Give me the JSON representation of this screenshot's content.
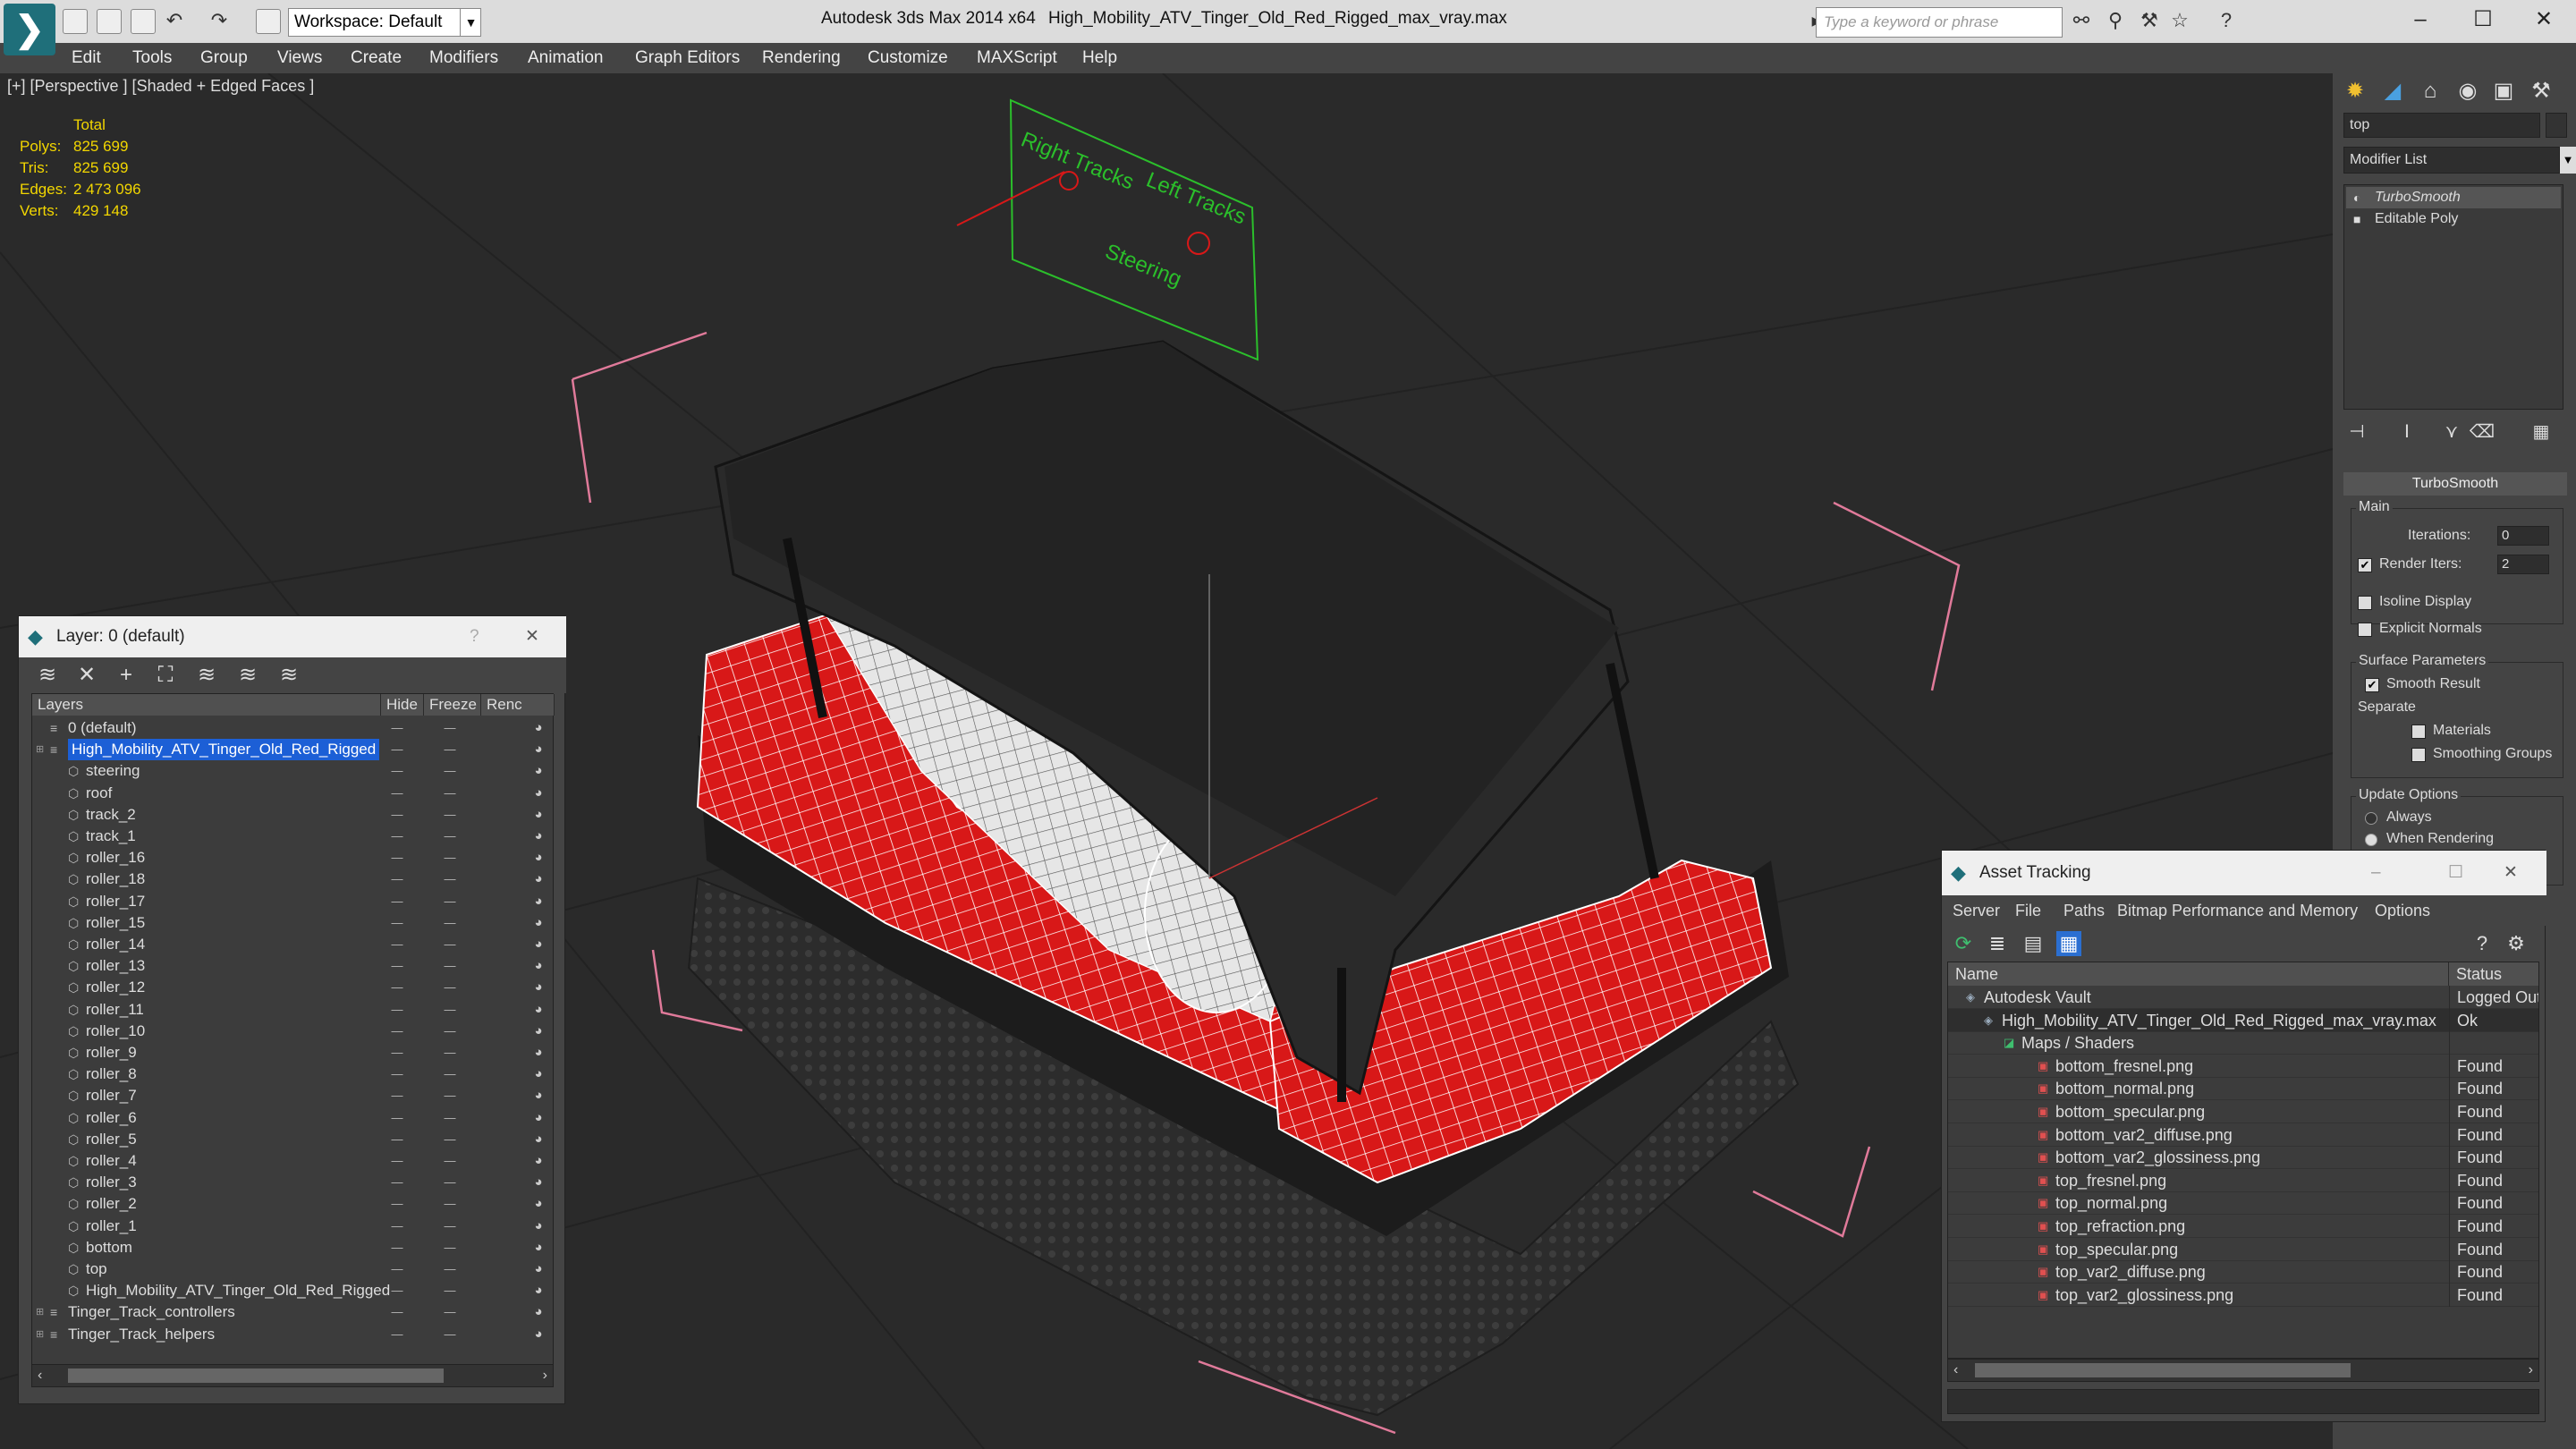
{
  "app": {
    "title": "Autodesk 3ds Max  2014 x64",
    "file": "High_Mobility_ATV_Tinger_Old_Red_Rigged_max_vray.max",
    "workspace": "Workspace: Default",
    "search_placeholder": "Type a keyword or phrase"
  },
  "menu": [
    "Edit",
    "Tools",
    "Group",
    "Views",
    "Create",
    "Modifiers",
    "Animation",
    "Graph Editors",
    "Rendering",
    "Customize",
    "MAXScript",
    "Help"
  ],
  "viewport": {
    "label": "[+] [Perspective ] [Shaded + Edged Faces ]",
    "stats": {
      "header": "Total",
      "rows": [
        {
          "label": "Polys:",
          "value": "825 699"
        },
        {
          "label": "Tris:",
          "value": "825 699"
        },
        {
          "label": "Edges:",
          "value": "2 473 096"
        },
        {
          "label": "Verts:",
          "value": "429 148"
        }
      ]
    },
    "helper_labels": [
      "Right Tracks",
      "Left Tracks",
      "Steering"
    ]
  },
  "layer_panel": {
    "title": "Layer: 0 (default)",
    "columns": [
      "Layers",
      "Hide",
      "Freeze",
      "Renc"
    ],
    "rows": [
      {
        "name": "0 (default)",
        "level": 0
      },
      {
        "name": "High_Mobility_ATV_Tinger_Old_Red_Rigged",
        "level": 0,
        "selected": true
      },
      {
        "name": "steering",
        "level": 1
      },
      {
        "name": "roof",
        "level": 1
      },
      {
        "name": "track_2",
        "level": 1
      },
      {
        "name": "track_1",
        "level": 1
      },
      {
        "name": "roller_16",
        "level": 1
      },
      {
        "name": "roller_18",
        "level": 1
      },
      {
        "name": "roller_17",
        "level": 1
      },
      {
        "name": "roller_15",
        "level": 1
      },
      {
        "name": "roller_14",
        "level": 1
      },
      {
        "name": "roller_13",
        "level": 1
      },
      {
        "name": "roller_12",
        "level": 1
      },
      {
        "name": "roller_11",
        "level": 1
      },
      {
        "name": "roller_10",
        "level": 1
      },
      {
        "name": "roller_9",
        "level": 1
      },
      {
        "name": "roller_8",
        "level": 1
      },
      {
        "name": "roller_7",
        "level": 1
      },
      {
        "name": "roller_6",
        "level": 1
      },
      {
        "name": "roller_5",
        "level": 1
      },
      {
        "name": "roller_4",
        "level": 1
      },
      {
        "name": "roller_3",
        "level": 1
      },
      {
        "name": "roller_2",
        "level": 1
      },
      {
        "name": "roller_1",
        "level": 1
      },
      {
        "name": "bottom",
        "level": 1
      },
      {
        "name": "top",
        "level": 1
      },
      {
        "name": "High_Mobility_ATV_Tinger_Old_Red_Rigged",
        "level": 1
      },
      {
        "name": "Tinger_Track_controllers",
        "level": 0
      },
      {
        "name": "Tinger_Track_helpers",
        "level": 0
      }
    ]
  },
  "command_panel": {
    "object_name": "top",
    "modifier_list": "Modifier List",
    "stack": [
      "TurboSmooth",
      "Editable Poly"
    ],
    "turbosmooth": {
      "title": "TurboSmooth",
      "main_label": "Main",
      "iterations_label": "Iterations:",
      "iterations_value": "0",
      "render_iters_label": "Render Iters:",
      "render_iters_value": "2",
      "isoline": "Isoline Display",
      "explicit_normals": "Explicit Normals",
      "surface_params": "Surface Parameters",
      "smooth_result": "Smooth Result",
      "separate": "Separate",
      "materials": "Materials",
      "smoothing_groups": "Smoothing Groups",
      "update_options": "Update Options",
      "always": "Always",
      "when_rendering": "When Rendering"
    }
  },
  "asset_panel": {
    "title": "Asset Tracking",
    "menu": [
      "Server",
      "File",
      "Paths",
      "Bitmap Performance and Memory",
      "Options"
    ],
    "columns": [
      "Name",
      "Status"
    ],
    "rows": [
      {
        "name": "Autodesk Vault",
        "status": "Logged Out",
        "level": 0
      },
      {
        "name": "High_Mobility_ATV_Tinger_Old_Red_Rigged_max_vray.max",
        "status": "Ok",
        "level": 1
      },
      {
        "name": "Maps / Shaders",
        "status": "",
        "level": 2
      },
      {
        "name": "bottom_fresnel.png",
        "status": "Found",
        "level": 3
      },
      {
        "name": "bottom_normal.png",
        "status": "Found",
        "level": 3
      },
      {
        "name": "bottom_specular.png",
        "status": "Found",
        "level": 3
      },
      {
        "name": "bottom_var2_diffuse.png",
        "status": "Found",
        "level": 3
      },
      {
        "name": "bottom_var2_glossiness.png",
        "status": "Found",
        "level": 3
      },
      {
        "name": "top_fresnel.png",
        "status": "Found",
        "level": 3
      },
      {
        "name": "top_normal.png",
        "status": "Found",
        "level": 3
      },
      {
        "name": "top_refraction.png",
        "status": "Found",
        "level": 3
      },
      {
        "name": "top_specular.png",
        "status": "Found",
        "level": 3
      },
      {
        "name": "top_var2_diffuse.png",
        "status": "Found",
        "level": 3
      },
      {
        "name": "top_var2_glossiness.png",
        "status": "Found",
        "level": 3
      }
    ]
  },
  "colors": {
    "selection": "#1c5fd6",
    "stats_text": "#f2d600",
    "model_red": "#d81818",
    "helper_green": "#2bbf2b",
    "helper_pink": "#e07a9a"
  }
}
